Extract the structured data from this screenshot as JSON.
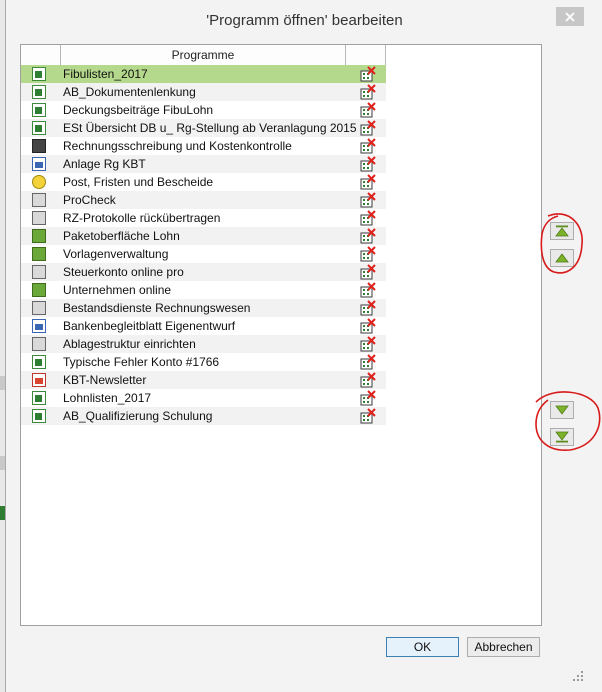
{
  "dialog": {
    "title": "'Programm öffnen' bearbeiten"
  },
  "list": {
    "column_header": "Programme",
    "items": [
      {
        "label": "Fibulisten_2017",
        "icon": "excel-icon"
      },
      {
        "label": "AB_Dokumentenlenkung",
        "icon": "excel-icon"
      },
      {
        "label": "Deckungsbeiträge FibuLohn",
        "icon": "excel-icon"
      },
      {
        "label": "ESt Übersicht DB u_ Rg-Stellung ab Veranlagung 2015",
        "icon": "excel-icon"
      },
      {
        "label": "Rechnungsschreibung und Kostenkontrolle",
        "icon": "invoice-icon"
      },
      {
        "label": "Anlage Rg KBT",
        "icon": "word-icon"
      },
      {
        "label": "Post, Fristen und Bescheide",
        "icon": "post-icon"
      },
      {
        "label": "ProCheck",
        "icon": "checklist-icon"
      },
      {
        "label": "RZ-Protokolle rückübertragen",
        "icon": "transfer-icon"
      },
      {
        "label": "Paketoberfläche Lohn",
        "icon": "package-icon"
      },
      {
        "label": "Vorlagenverwaltung",
        "icon": "template-icon"
      },
      {
        "label": "Steuerkonto online pro",
        "icon": "tax-account-icon"
      },
      {
        "label": "Unternehmen online",
        "icon": "company-online-icon"
      },
      {
        "label": "Bestandsdienste Rechnungswesen",
        "icon": "chart-icon"
      },
      {
        "label": "Bankenbegleitblatt Eigenentwurf",
        "icon": "word-icon"
      },
      {
        "label": "Ablagestruktur einrichten",
        "icon": "folder-icon"
      },
      {
        "label": "Typische Fehler Konto #1766",
        "icon": "excel-icon"
      },
      {
        "label": "KBT-Newsletter",
        "icon": "pdf-icon"
      },
      {
        "label": "Lohnlisten_2017",
        "icon": "excel-icon"
      },
      {
        "label": "AB_Qualifizierung Schulung",
        "icon": "excel-icon"
      }
    ]
  },
  "buttons": {
    "ok": "OK",
    "cancel": "Abbrechen"
  },
  "colors": {
    "selected_row": "#b5d98c",
    "annotation": "#d81a1a",
    "arrow_green": "#7cb32a"
  }
}
